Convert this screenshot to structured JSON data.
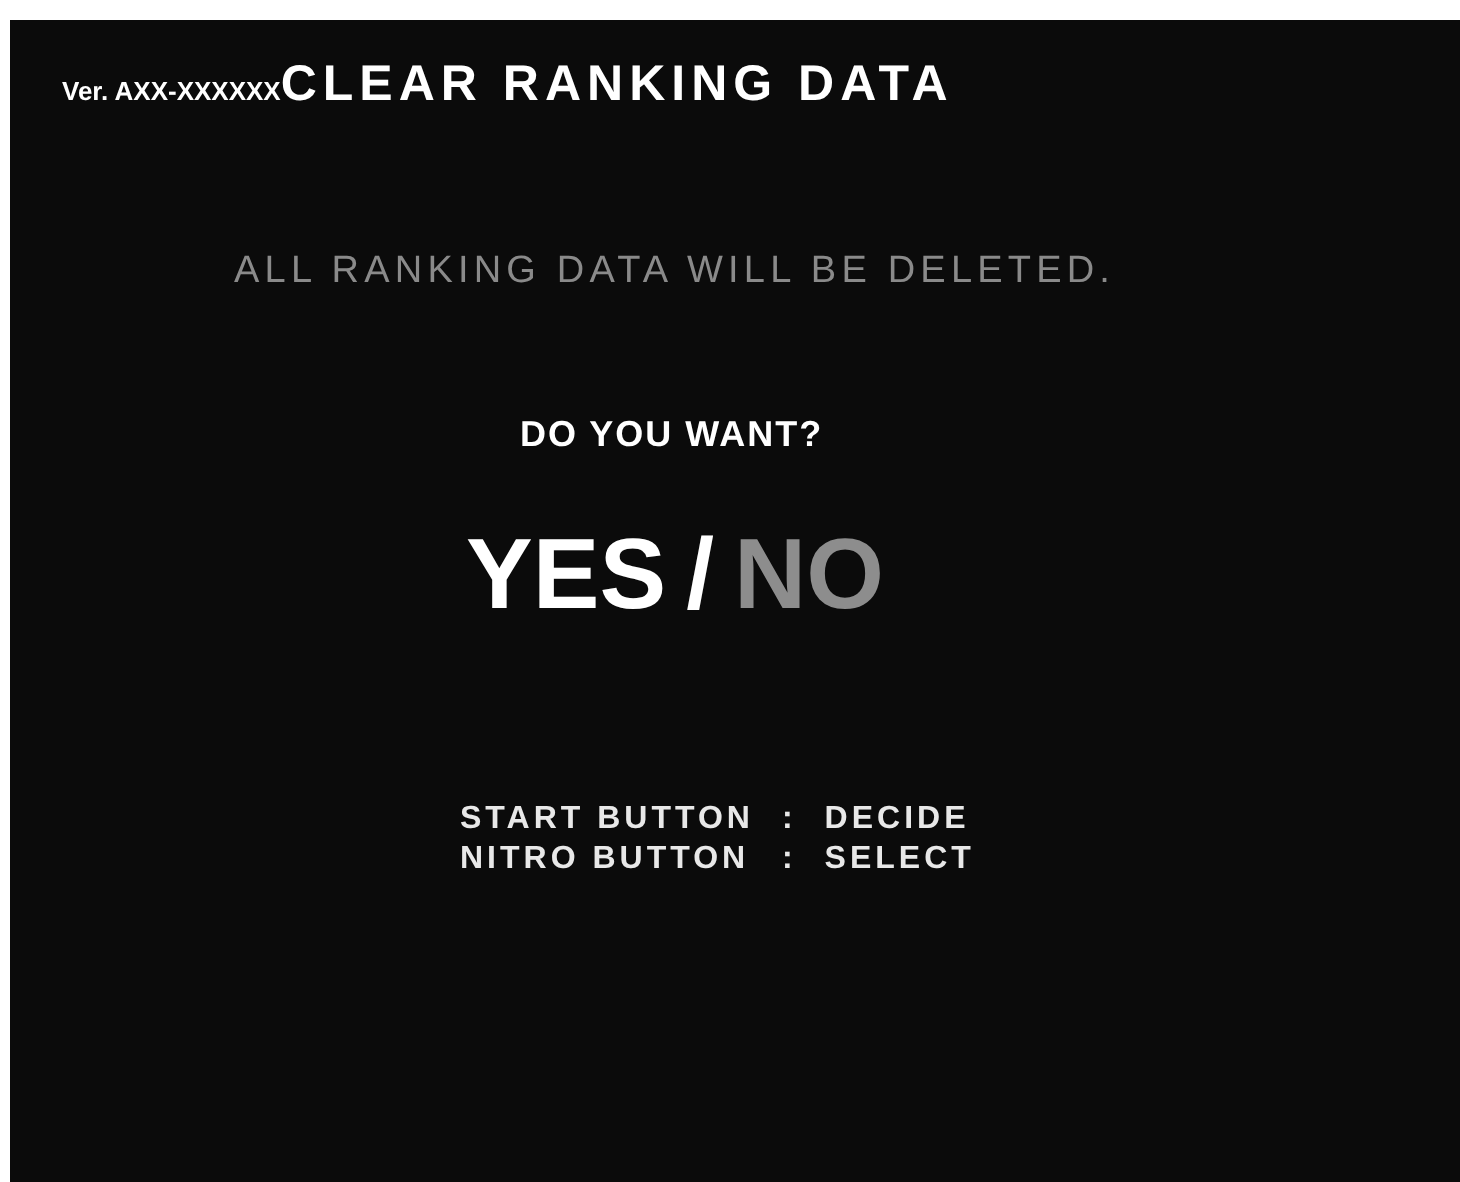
{
  "header": {
    "version": "Ver. AXX-XXXXXX",
    "title": "CLEAR RANKING DATA"
  },
  "message": "ALL RANKING DATA WILL BE DELETED.",
  "question": "DO YOU WANT?",
  "options": [
    {
      "label": "YES",
      "selected": true
    },
    {
      "label": "NO",
      "selected": false
    }
  ],
  "option_separator": "/",
  "controls": [
    {
      "button": "START BUTTON",
      "separator": ":",
      "action": "DECIDE"
    },
    {
      "button": "NITRO BUTTON",
      "separator": ":",
      "action": "SELECT"
    }
  ]
}
